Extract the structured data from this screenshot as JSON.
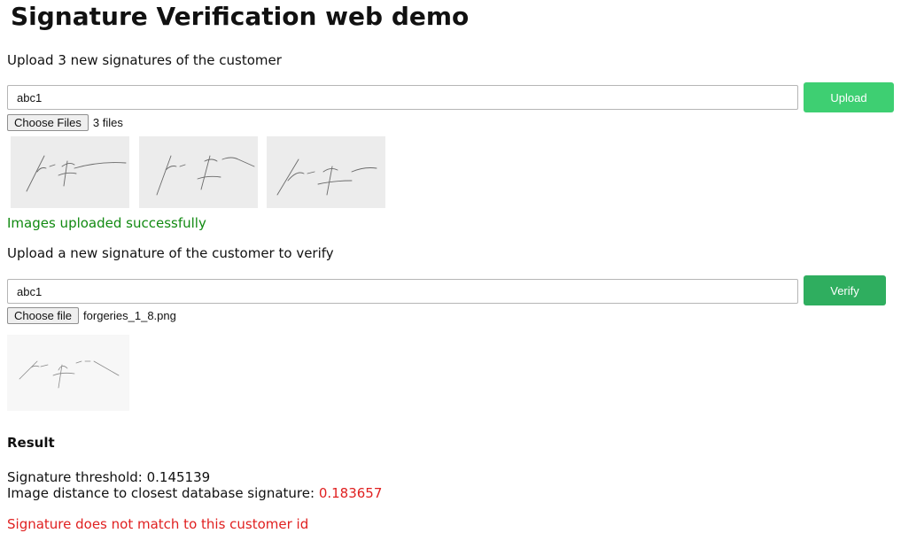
{
  "page": {
    "title": "Signature Verification web demo"
  },
  "enroll": {
    "instruction": "Upload 3 new signatures of the customer",
    "customer_id_value": "abc1",
    "upload_label": "Upload",
    "choose_files_label": "Choose Files",
    "file_status": "3 files",
    "thumbnails": [
      "signature-image",
      "signature-image",
      "signature-image"
    ],
    "success_message": "Images uploaded successfully"
  },
  "verify": {
    "instruction": "Upload a new signature of the customer to verify",
    "customer_id_value": "abc1",
    "verify_label": "Verify",
    "choose_file_label": "Choose file",
    "file_name": "forgeries_1_8.png"
  },
  "result": {
    "heading": "Result",
    "threshold_label": "Signature threshold:",
    "threshold_value": "0.145139",
    "distance_label": "Image distance to closest database signature:",
    "distance_value": "0.183657",
    "verdict": "Signature does not match to this customer id"
  },
  "colors": {
    "upload_button": "#3ecf72",
    "verify_button": "#2fae5f",
    "success_text": "#118a11",
    "error_text": "#e02020"
  }
}
